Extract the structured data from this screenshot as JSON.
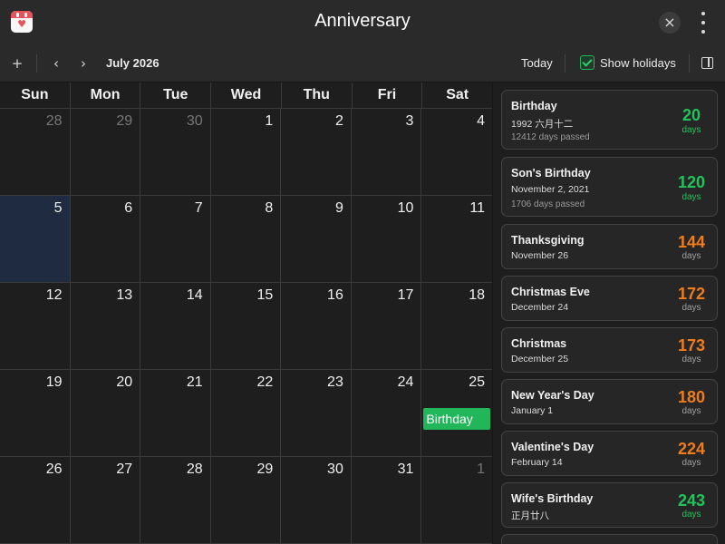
{
  "window": {
    "title": "Anniversary"
  },
  "toolbar": {
    "add_label": "+",
    "prev_label": "‹",
    "next_label": "›",
    "month_label": "July 2026",
    "today_label": "Today",
    "show_holidays_label": "Show holidays",
    "show_holidays_checked": true
  },
  "calendar": {
    "weekdays": [
      "Sun",
      "Mon",
      "Tue",
      "Wed",
      "Thu",
      "Fri",
      "Sat"
    ],
    "days": [
      "28",
      "29",
      "30",
      "1",
      "2",
      "3",
      "4",
      "5",
      "6",
      "7",
      "8",
      "9",
      "10",
      "11",
      "12",
      "13",
      "14",
      "15",
      "16",
      "17",
      "18",
      "19",
      "20",
      "21",
      "22",
      "23",
      "24",
      "25",
      "26",
      "27",
      "28",
      "29",
      "30",
      "31",
      "1"
    ],
    "events": [
      {
        "day": "25",
        "label": "Birthday",
        "color": "#22b65b"
      }
    ]
  },
  "sidebar": {
    "cards": [
      {
        "name": "Birthday",
        "date": "1992 六月十二",
        "passed": "12412 days passed",
        "count": "20",
        "unit": "days",
        "color": "green"
      },
      {
        "name": "Son's Birthday",
        "date": "November 2, 2021",
        "passed": "1706 days passed",
        "count": "120",
        "unit": "days",
        "color": "green"
      },
      {
        "name": "Thanksgiving",
        "date": "November 26",
        "count": "144",
        "unit": "days",
        "color": "orange"
      },
      {
        "name": "Christmas Eve",
        "date": "December 24",
        "count": "172",
        "unit": "days",
        "color": "orange"
      },
      {
        "name": "Christmas",
        "date": "December 25",
        "count": "173",
        "unit": "days",
        "color": "orange"
      },
      {
        "name": "New Year's Day",
        "date": "January 1",
        "count": "180",
        "unit": "days",
        "color": "orange"
      },
      {
        "name": "Valentine's Day",
        "date": "February 14",
        "count": "224",
        "unit": "days",
        "color": "orange"
      },
      {
        "name": "Wife's Birthday",
        "date": "正月廿八",
        "count": "243",
        "unit": "days",
        "color": "green"
      }
    ]
  }
}
